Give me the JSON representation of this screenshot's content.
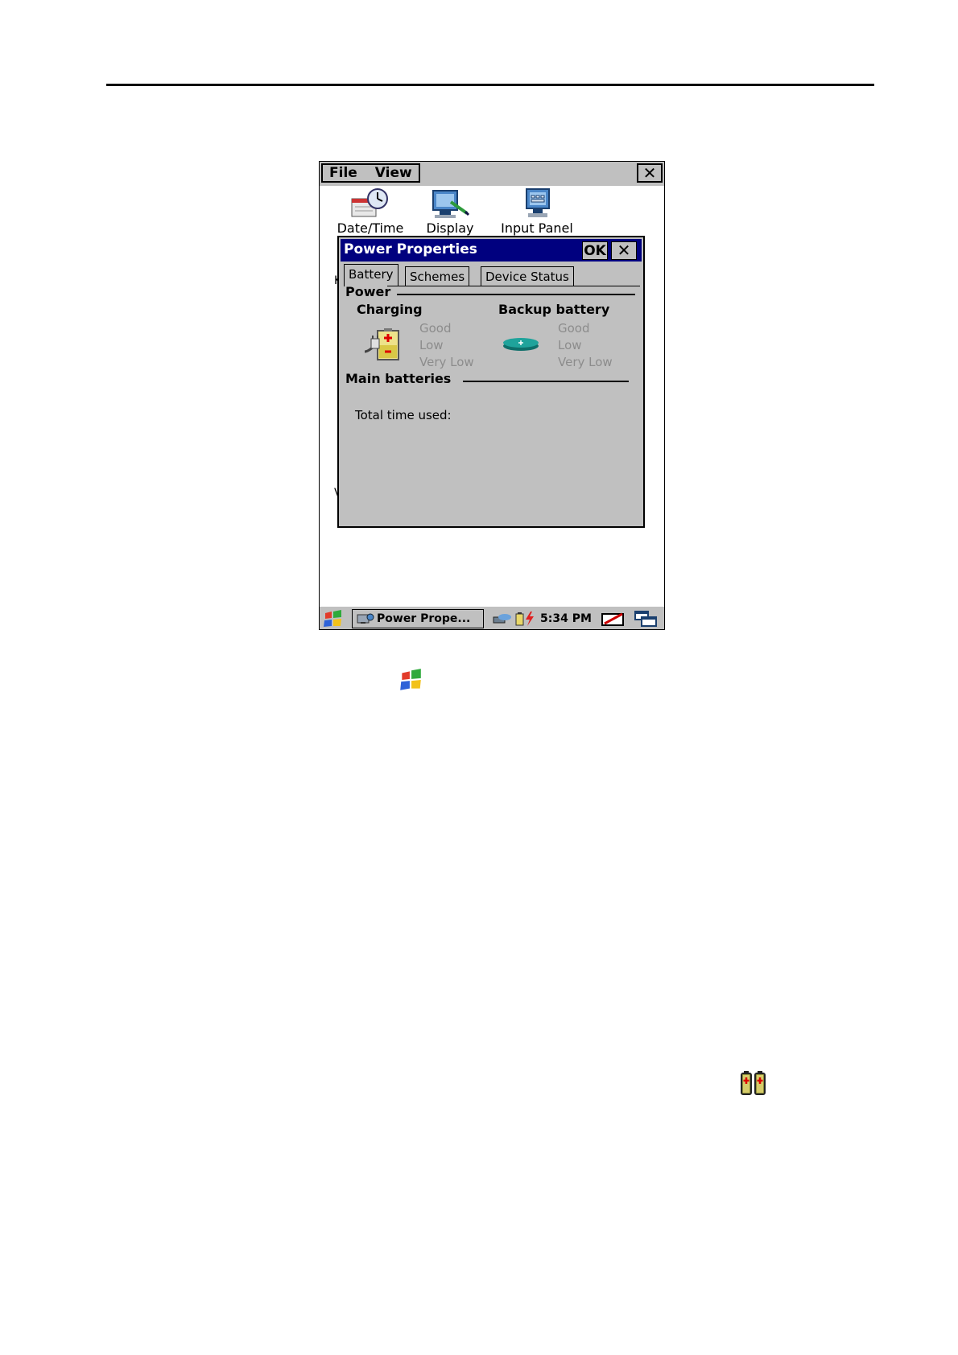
{
  "control_panel": {
    "menu": [
      "File",
      "View"
    ],
    "close_symbol": "✕",
    "icons": [
      {
        "label": "Date/Time",
        "icon": "clock-calendar-icon"
      },
      {
        "label": "Display",
        "icon": "display-icon"
      },
      {
        "label": "Input Panel",
        "icon": "keyboard-monitor-icon"
      }
    ],
    "clipped_letters": [
      "K",
      "V"
    ]
  },
  "dialog": {
    "title": "Power Properties",
    "ok_label": "OK",
    "close_symbol": "✕",
    "tabs": [
      "Battery",
      "Schemes",
      "Device Status"
    ],
    "power_section": "Power",
    "charging": {
      "title": "Charging",
      "levels": [
        "Good",
        "Low",
        "Very Low"
      ],
      "icon": "charging-battery-icon"
    },
    "backup": {
      "title": "Backup battery",
      "levels": [
        "Good",
        "Low",
        "Very Low"
      ],
      "icon": "coin-battery-icon"
    },
    "main_section": "Main batteries",
    "total_time_label": "Total time used:"
  },
  "taskbar": {
    "task_label": "Power Prope...",
    "time": "5:34 PM"
  },
  "colors": {
    "titlebar": "#00007f",
    "dialog_bg": "#c0c0c0",
    "disabled_text": "#8c8c8c"
  }
}
